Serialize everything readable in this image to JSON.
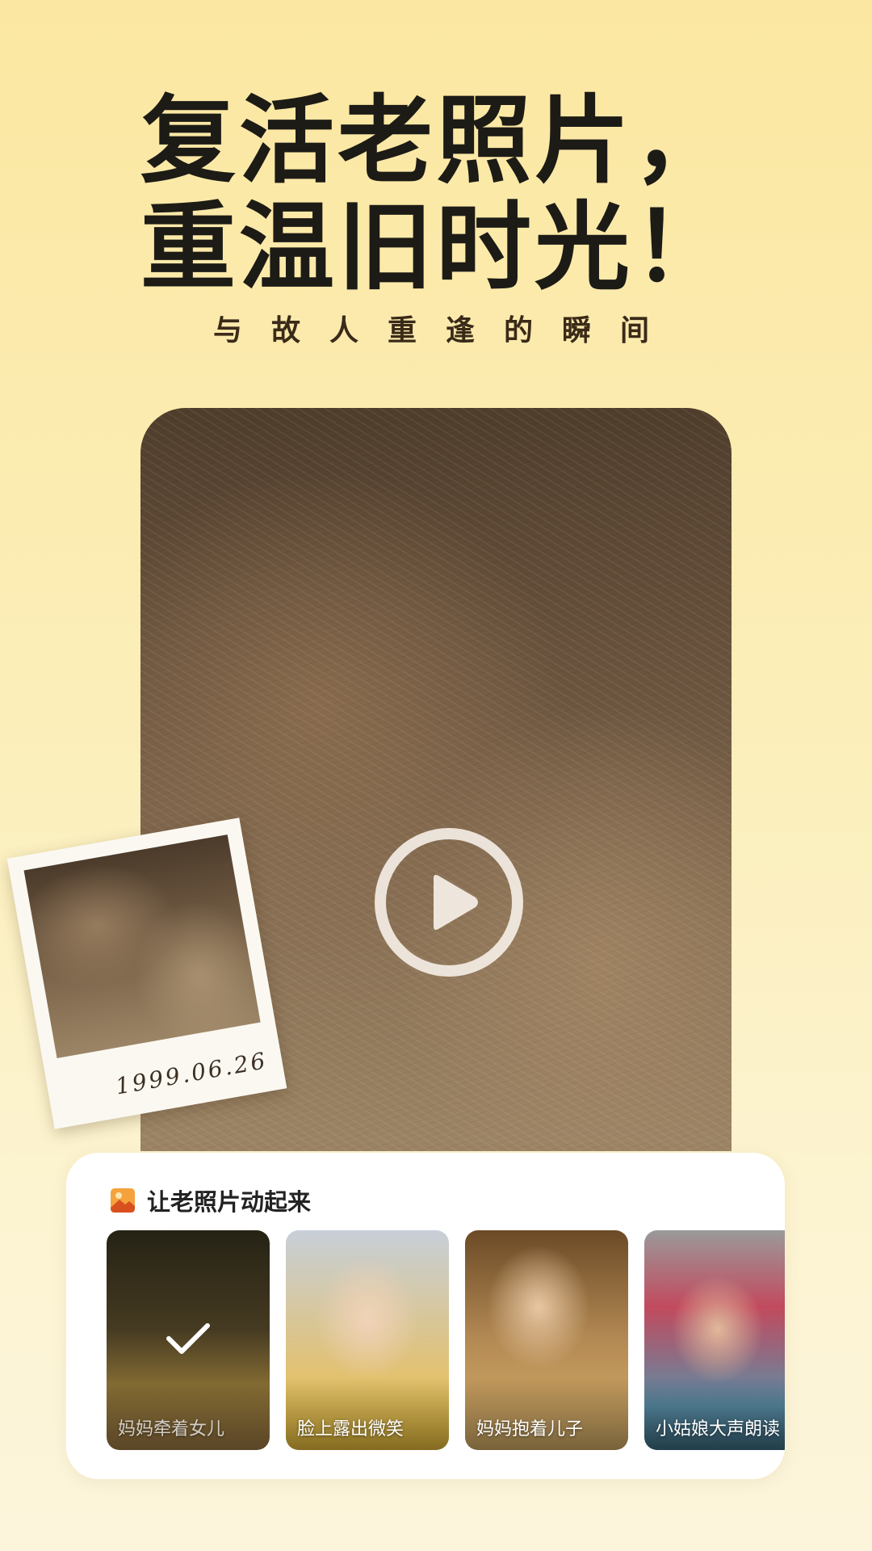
{
  "hero": {
    "title_line1": "复活老照片，",
    "title_line2": "重温旧时光！",
    "subtitle": "与故人重逢的瞬间"
  },
  "main_photo": {
    "description_icon": "play-icon"
  },
  "polaroid": {
    "date": "1999.06.26"
  },
  "panel": {
    "title": "让老照片动起来",
    "icon": "photo-icon",
    "templates": [
      {
        "label": "妈妈牵着女儿",
        "selected": true
      },
      {
        "label": "脸上露出微笑",
        "selected": false
      },
      {
        "label": "妈妈抱着儿子",
        "selected": false
      },
      {
        "label": "小姑娘大声朗读",
        "selected": false
      }
    ]
  },
  "colors": {
    "background_top": "#fbe7a1",
    "background_bottom": "#fcf5dc",
    "title": "#1d1b16",
    "accent_icon": "#e8742c"
  }
}
